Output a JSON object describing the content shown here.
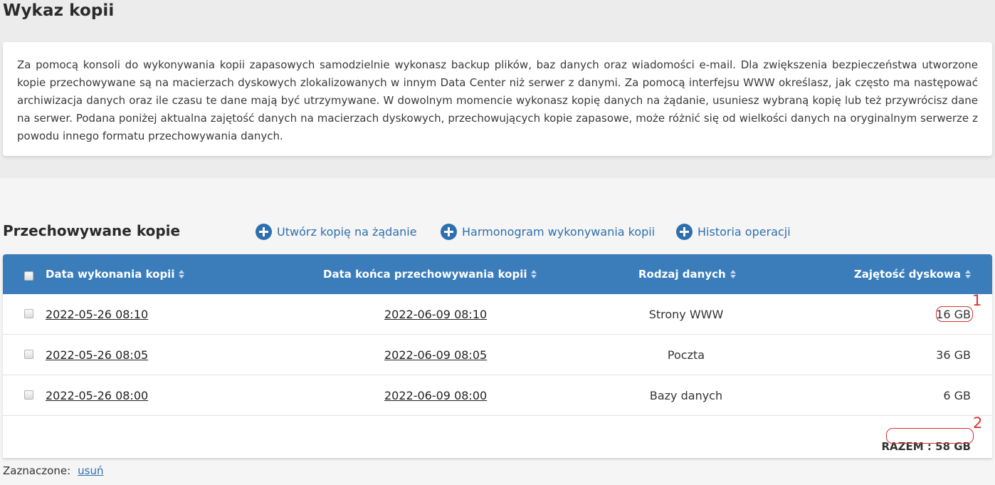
{
  "page": {
    "title": "Wykaz kopii",
    "description": "Za pomocą konsoli do wykonywania kopii zapasowych samodzielnie wykonasz backup plików, baz danych oraz wiadomości e-mail. Dla zwiększenia bezpieczeństwa utworzone kopie przechowywane są na macierzach dyskowych zlokalizowanych w innym Data Center niż serwer z danymi. Za pomocą interfejsu WWW określasz, jak często ma następować archiwizacja danych oraz ile czasu te dane mają być utrzymywane. W dowolnym momencie wykonasz kopię danych na żądanie, usuniesz wybraną kopię lub też przywrócisz dane na serwer. Podana poniżej aktualna zajętość danych na macierzach dyskowych, przechowujących kopie zapasowe, może różnić się od wielkości danych na oryginalnym serwerze z powodu innego formatu przechowywania danych."
  },
  "section": {
    "title": "Przechowywane kopie",
    "actions": [
      {
        "label": "Utwórz kopię na żądanie",
        "icon": "plus-circle-icon"
      },
      {
        "label": "Harmonogram wykonywania kopii",
        "icon": "plus-circle-icon"
      },
      {
        "label": "Historia operacji",
        "icon": "plus-circle-icon"
      }
    ]
  },
  "table": {
    "columns": [
      {
        "label": "Data wykonania kopii"
      },
      {
        "label": "Data końca przechowywania kopii"
      },
      {
        "label": "Rodzaj danych"
      },
      {
        "label": "Zajętość dyskowa"
      }
    ],
    "rows": [
      {
        "created": "2022-05-26 08:10",
        "expires": "2022-06-09 08:10",
        "type": "Strony WWW",
        "size": "16 GB"
      },
      {
        "created": "2022-05-26 08:05",
        "expires": "2022-06-09 08:05",
        "type": "Poczta",
        "size": "36 GB"
      },
      {
        "created": "2022-05-26 08:00",
        "expires": "2022-06-09 08:00",
        "type": "Bazy danych",
        "size": "6 GB"
      }
    ],
    "total": "RAZEM : 58 GB"
  },
  "annotations": {
    "one": "1",
    "two": "2",
    "color": "#d93030"
  },
  "footer": {
    "selected_label": "Zaznaczone:",
    "delete_label": "usuń"
  },
  "colors": {
    "header_bg": "#3b7dbb",
    "link": "#2f6fae"
  }
}
